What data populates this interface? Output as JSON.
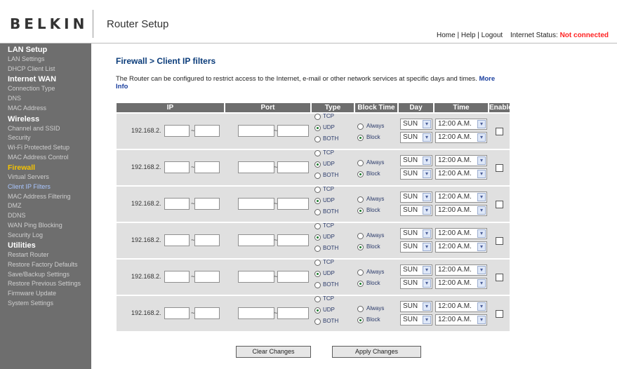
{
  "header": {
    "logo": "BELKIN",
    "app_title": "Router Setup",
    "links": [
      "Home",
      "Help",
      "Logout"
    ],
    "separator": " | ",
    "status_label": "Internet Status:",
    "status_value": "Not connected",
    "status_color": "#ff2222"
  },
  "sidebar": {
    "sections": [
      {
        "title": "LAN Setup",
        "items": [
          {
            "label": "LAN Settings"
          },
          {
            "label": "DHCP Client List"
          }
        ]
      },
      {
        "title": "Internet WAN",
        "items": [
          {
            "label": "Connection Type"
          },
          {
            "label": "DNS"
          },
          {
            "label": "MAC Address"
          }
        ]
      },
      {
        "title": "Wireless",
        "items": [
          {
            "label": "Channel and SSID"
          },
          {
            "label": "Security"
          },
          {
            "label": "Wi-Fi Protected Setup"
          },
          {
            "label": "MAC Address Control"
          }
        ]
      },
      {
        "title": "Firewall",
        "highlight": true,
        "items": [
          {
            "label": "Virtual Servers"
          },
          {
            "label": "Client IP Filters",
            "current": true
          },
          {
            "label": "MAC Address Filtering"
          },
          {
            "label": "DMZ"
          },
          {
            "label": "DDNS"
          },
          {
            "label": "WAN Ping Blocking"
          },
          {
            "label": "Security Log"
          }
        ]
      },
      {
        "title": "Utilities",
        "items": [
          {
            "label": "Restart Router"
          },
          {
            "label": "Restore Factory Defaults"
          },
          {
            "label": "Save/Backup Settings"
          },
          {
            "label": "Restore Previous Settings"
          },
          {
            "label": "Firmware Update"
          },
          {
            "label": "System Settings"
          }
        ]
      }
    ],
    "highlight_color": "#f6c400",
    "current_color": "#a9c6ff"
  },
  "main": {
    "title": "Firewall > Client IP filters",
    "description": "The Router can be configured to restrict access to the Internet, e-mail or other network services at specific days and times.",
    "more_info": "More Info"
  },
  "table": {
    "headers": [
      "IP",
      "Port",
      "Type",
      "Block Time",
      "Day",
      "Time",
      "Enable"
    ],
    "ip_prefix": "192.168.2.",
    "range_sep": "~",
    "type_options": [
      "TCP",
      "UDP",
      "BOTH"
    ],
    "block_options": [
      "Always",
      "Block"
    ],
    "rows": [
      {
        "ip_start": "",
        "ip_end": "",
        "port_start": "",
        "port_end": "",
        "type": "UDP",
        "block": "Block",
        "day_from": "SUN",
        "day_to": "SUN",
        "time_from": "12:00 A.M.",
        "time_to": "12:00 A.M.",
        "enabled": false
      },
      {
        "ip_start": "",
        "ip_end": "",
        "port_start": "",
        "port_end": "",
        "type": "UDP",
        "block": "Block",
        "day_from": "SUN",
        "day_to": "SUN",
        "time_from": "12:00 A.M.",
        "time_to": "12:00 A.M.",
        "enabled": false
      },
      {
        "ip_start": "",
        "ip_end": "",
        "port_start": "",
        "port_end": "",
        "type": "UDP",
        "block": "Block",
        "day_from": "SUN",
        "day_to": "SUN",
        "time_from": "12:00 A.M.",
        "time_to": "12:00 A.M.",
        "enabled": false
      },
      {
        "ip_start": "",
        "ip_end": "",
        "port_start": "",
        "port_end": "",
        "type": "UDP",
        "block": "Block",
        "day_from": "SUN",
        "day_to": "SUN",
        "time_from": "12:00 A.M.",
        "time_to": "12:00 A.M.",
        "enabled": false
      },
      {
        "ip_start": "",
        "ip_end": "",
        "port_start": "",
        "port_end": "",
        "type": "UDP",
        "block": "Block",
        "day_from": "SUN",
        "day_to": "SUN",
        "time_from": "12:00 A.M.",
        "time_to": "12:00 A.M.",
        "enabled": false
      },
      {
        "ip_start": "",
        "ip_end": "",
        "port_start": "",
        "port_end": "",
        "type": "UDP",
        "block": "Block",
        "day_from": "SUN",
        "day_to": "SUN",
        "time_from": "12:00 A.M.",
        "time_to": "12:00 A.M.",
        "enabled": false
      }
    ]
  },
  "buttons": {
    "clear": "Clear Changes",
    "apply": "Apply Changes"
  }
}
